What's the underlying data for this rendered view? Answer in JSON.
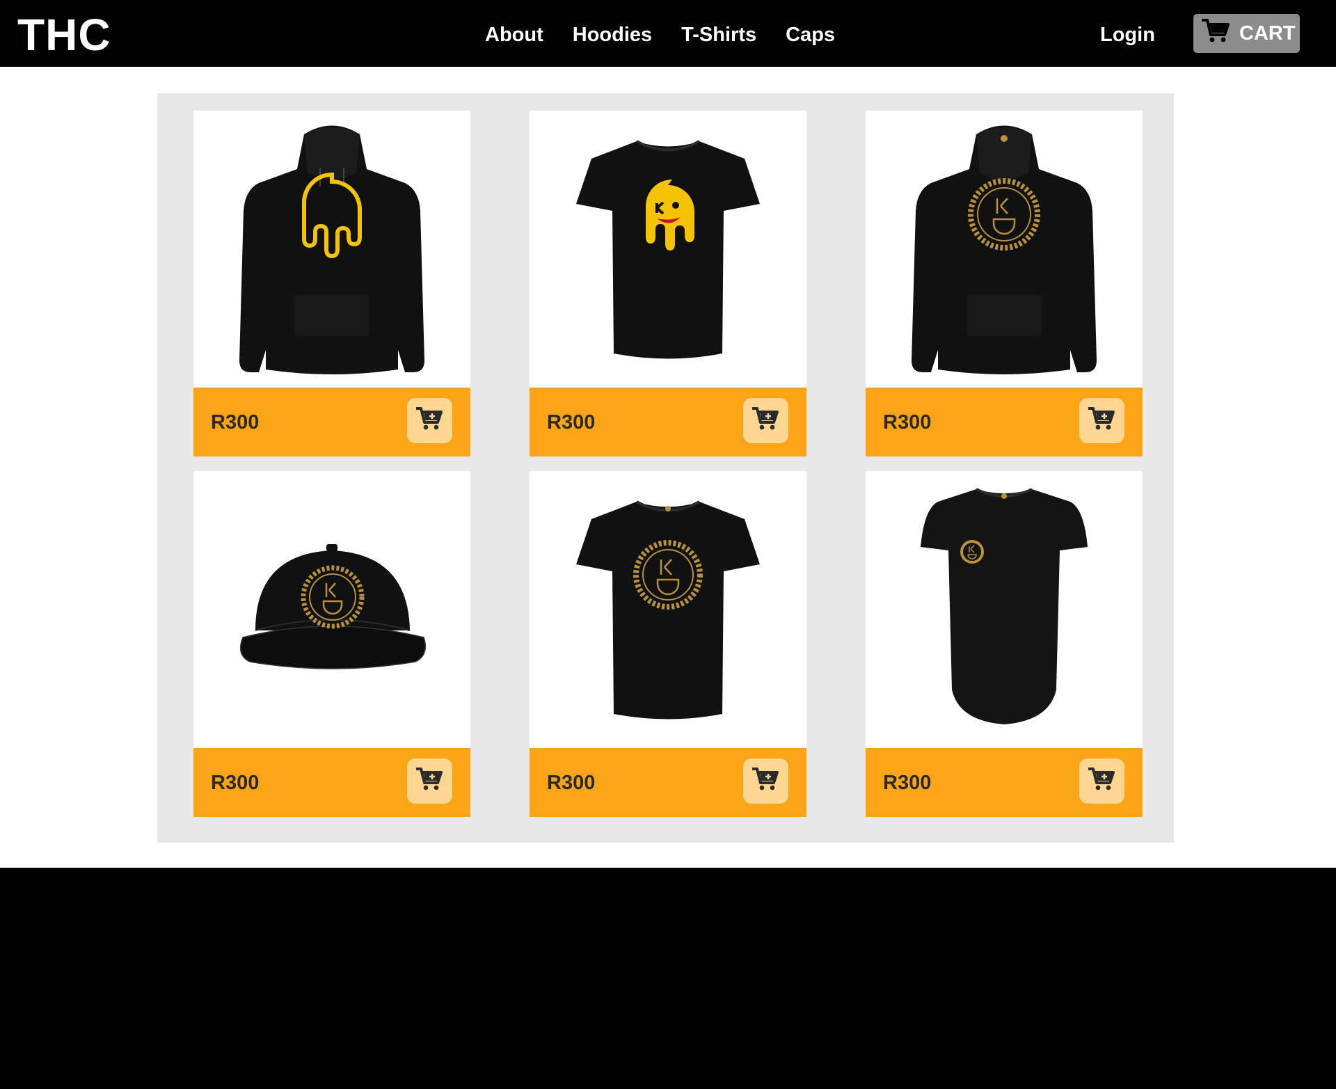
{
  "nav": {
    "brand": "THC",
    "links": [
      "About",
      "Hoodies",
      "T-Shirts",
      "Caps"
    ],
    "login": "Login",
    "cart_label": "CART"
  },
  "products": [
    {
      "price": "R300",
      "kind": "hoodie",
      "print": "yellow-drip-smiley"
    },
    {
      "price": "R300",
      "kind": "t-shirt",
      "print": "yellow-drip-smiley-filled"
    },
    {
      "price": "R300",
      "kind": "hoodie",
      "print": "gold-greek-key-logo"
    },
    {
      "price": "R300",
      "kind": "cap",
      "print": "gold-greek-key-logo"
    },
    {
      "price": "R300",
      "kind": "t-shirt",
      "print": "gold-greek-key-logo"
    },
    {
      "price": "R300",
      "kind": "long-t-shirt",
      "print": "small-gold-chest-logo"
    }
  ],
  "colors": {
    "navbar": "#000000",
    "accent": "#fba516",
    "add_button": "#fdd792",
    "panel": "#e8e8e8",
    "cart_button": "#8c8c8c",
    "logo_yellow": "#f5c400",
    "logo_gold": "#b8913a"
  },
  "icons": {
    "cart": "shopping-cart-icon",
    "add_to_cart": "cart-plus-icon"
  }
}
